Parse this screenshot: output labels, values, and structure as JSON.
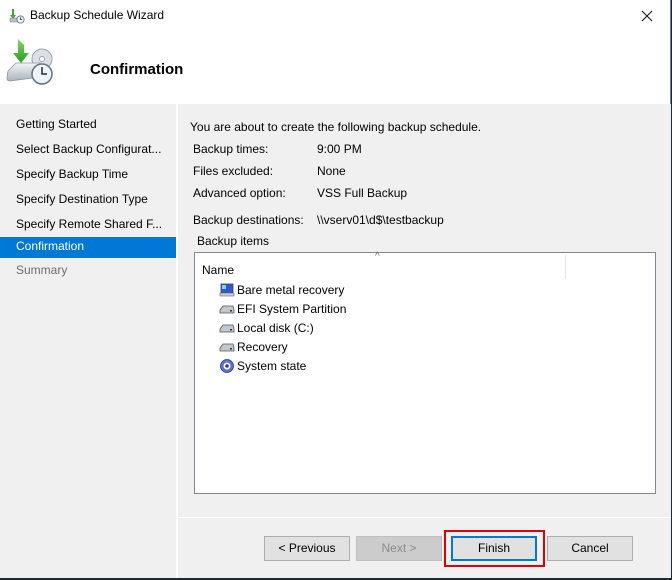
{
  "window": {
    "title": "Backup Schedule Wizard",
    "close_icon": "close-icon",
    "app_icon": "backup-schedule-icon"
  },
  "header": {
    "title": "Confirmation",
    "icon": "backup-wizard-icon"
  },
  "sidebar": {
    "items": [
      {
        "label": "Getting Started",
        "state": "normal"
      },
      {
        "label": "Select Backup Configurat...",
        "state": "normal"
      },
      {
        "label": "Specify Backup Time",
        "state": "normal"
      },
      {
        "label": "Specify Destination Type",
        "state": "normal"
      },
      {
        "label": "Specify Remote Shared F...",
        "state": "normal"
      },
      {
        "label": "Confirmation",
        "state": "active"
      },
      {
        "label": "Summary",
        "state": "disabled"
      }
    ]
  },
  "content": {
    "intro": "You are about to create the following backup schedule.",
    "details": [
      {
        "label": "Backup times:",
        "value": "9:00 PM"
      },
      {
        "label": "Files excluded:",
        "value": "None"
      },
      {
        "label": "Advanced option:",
        "value": "VSS Full Backup"
      },
      {
        "label": "Backup destinations:",
        "value": "\\\\vserv01\\d$\\testbackup"
      }
    ],
    "backup_items_label": "Backup items",
    "list": {
      "column_header": "Name",
      "sort_indicator": "^",
      "items": [
        {
          "label": "Bare metal recovery",
          "icon": "computer-icon"
        },
        {
          "label": "EFI System Partition",
          "icon": "drive-icon"
        },
        {
          "label": "Local disk (C:)",
          "icon": "drive-icon"
        },
        {
          "label": "Recovery",
          "icon": "drive-icon"
        },
        {
          "label": "System state",
          "icon": "system-state-icon"
        }
      ]
    }
  },
  "footer": {
    "previous_label": "< Previous",
    "next_label": "Next >",
    "finish_label": "Finish",
    "cancel_label": "Cancel"
  },
  "colors": {
    "accent": "#0078d7",
    "highlight": "#e00000",
    "panel_bg": "#f0f0f0"
  }
}
